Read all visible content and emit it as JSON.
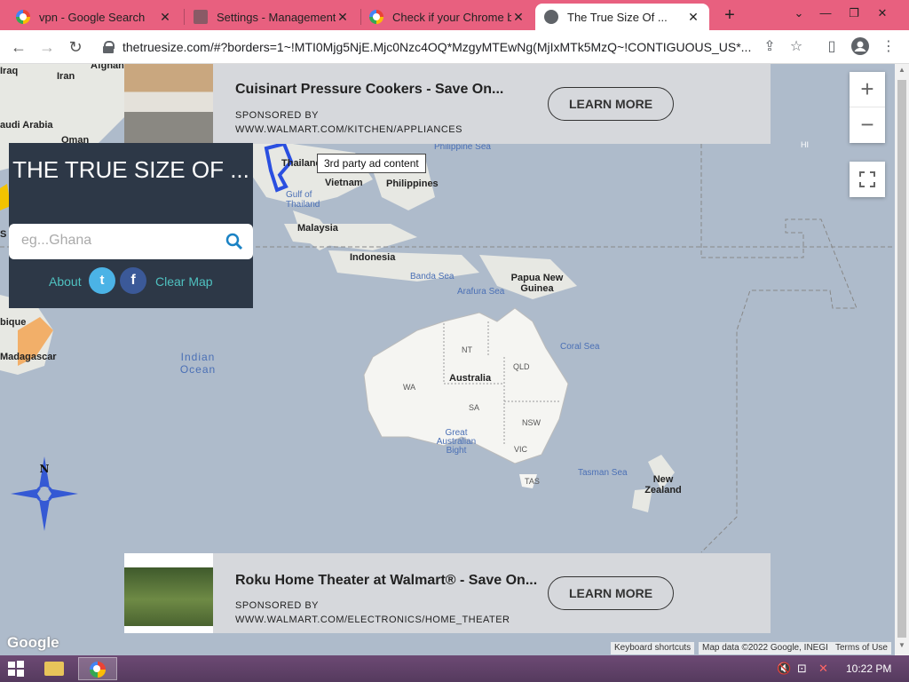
{
  "browser": {
    "tabs": [
      {
        "title": "vpn - Google Search",
        "close": "✕"
      },
      {
        "title": "Settings - Management",
        "close": "✕"
      },
      {
        "title": "Check if your Chrome br",
        "close": "✕"
      },
      {
        "title": "The True Size Of ...",
        "close": "✕"
      }
    ],
    "new_tab": "+",
    "tab_menu": "⌄",
    "window": {
      "minimize": "—",
      "restore": "❐",
      "close": "✕"
    },
    "nav": {
      "back": "←",
      "forward": "→",
      "reload": "↻"
    },
    "url": "thetruesize.com/#?borders=1~!MTI0Mjg5NjE.Mjc0Nzc4OQ*MzgyMTEwNg(MjIxMTk5MzQ~!CONTIGUOUS_US*...",
    "toolbar_icons": [
      "share-icon",
      "star-icon",
      "sidebar-icon",
      "profile-icon",
      "menu-icon"
    ]
  },
  "map": {
    "labels": [
      {
        "text": "Iraq",
        "kind": "land"
      },
      {
        "text": "Iran",
        "kind": "land"
      },
      {
        "text": "Afghan",
        "kind": "land"
      },
      {
        "text": "audi Arabia",
        "kind": "land"
      },
      {
        "text": "Oman",
        "kind": "land"
      },
      {
        "text": "Thailand",
        "kind": "land"
      },
      {
        "text": "Vietnam",
        "kind": "land"
      },
      {
        "text": "Philippines",
        "kind": "land"
      },
      {
        "text": "Philippine Sea",
        "kind": "water"
      },
      {
        "text": "Gulf of Thailand",
        "kind": "water"
      },
      {
        "text": "Malaysia",
        "kind": "land"
      },
      {
        "text": "Indonesia",
        "kind": "land"
      },
      {
        "text": "Banda Sea",
        "kind": "water"
      },
      {
        "text": "Arafura Sea",
        "kind": "water"
      },
      {
        "text": "Papua New Guinea",
        "kind": "land"
      },
      {
        "text": "Coral Sea",
        "kind": "water"
      },
      {
        "text": "Indian Ocean",
        "kind": "water"
      },
      {
        "text": "NT",
        "kind": "state"
      },
      {
        "text": "QLD",
        "kind": "state"
      },
      {
        "text": "WA",
        "kind": "state"
      },
      {
        "text": "Australia",
        "kind": "land"
      },
      {
        "text": "SA",
        "kind": "state"
      },
      {
        "text": "NSW",
        "kind": "state"
      },
      {
        "text": "VIC",
        "kind": "state"
      },
      {
        "text": "Great Australian Bight",
        "kind": "water"
      },
      {
        "text": "TAS",
        "kind": "state"
      },
      {
        "text": "Tasman Sea",
        "kind": "water"
      },
      {
        "text": "New Zealand",
        "kind": "land"
      },
      {
        "text": "Madagascar",
        "kind": "land"
      },
      {
        "text": "bique",
        "kind": "land"
      },
      {
        "text": "HI",
        "kind": "state"
      },
      {
        "text": "S",
        "kind": "land"
      }
    ],
    "compass_letter": "N",
    "zoom_in": "+",
    "zoom_out": "−",
    "fullscreen": "⛶",
    "google_logo": "Google",
    "attribution": [
      "Keyboard shortcuts",
      "Map data ©2022 Google, INEGI",
      "Terms of Use"
    ]
  },
  "ads": [
    {
      "headline": "Cuisinart Pressure Cookers - Save On...",
      "sponsored": "SPONSORED BY",
      "domain": "WWW.WALMART.COM/KITCHEN/APPLIANCES",
      "cta": "LEARN MORE"
    },
    {
      "headline": "Roku Home Theater at Walmart® - Save On...",
      "sponsored": "SPONSORED BY",
      "domain": "WWW.WALMART.COM/ELECTRONICS/HOME_THEATER",
      "cta": "LEARN MORE"
    }
  ],
  "tooltip": "3rd party ad content",
  "truesize": {
    "title": "THE TRUE SIZE OF ...",
    "search_placeholder": "eg...Ghana",
    "about": "About",
    "twitter": "t",
    "facebook": "f",
    "clear": "Clear Map"
  },
  "taskbar": {
    "clock": "10:22 PM"
  },
  "colors": {
    "tabbar": "#e8607f",
    "ocean": "#aebbcb",
    "panel": "#2d3847",
    "panel_link": "#4fc1c0",
    "highlight_blue": "#2a4fe0",
    "highlight_orange": "#f5a04a"
  }
}
